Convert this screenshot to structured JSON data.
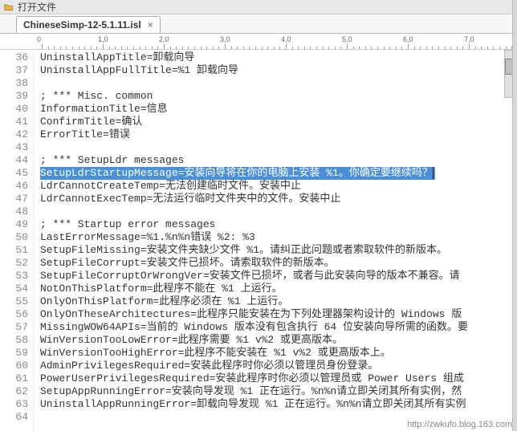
{
  "topbar": {
    "label": "打开文件"
  },
  "tab": {
    "filename": "ChineseSimp-12-5.1.11.isl",
    "close": "×"
  },
  "ruler": {
    "marks": [
      "0",
      "1,0",
      "2,0",
      "3,0",
      "4,0",
      "5,0",
      "6,0",
      "7,0"
    ]
  },
  "footer": {
    "url": "http://zwkufo.blog.163.com"
  },
  "lines": [
    {
      "n": 36,
      "t": "UninstallAppTitle=卸载向导"
    },
    {
      "n": 37,
      "t": "UninstallAppFullTitle=%1 卸载向导"
    },
    {
      "n": 38,
      "t": ""
    },
    {
      "n": 39,
      "t": "; *** Misc. common"
    },
    {
      "n": 40,
      "t": "InformationTitle=信息"
    },
    {
      "n": 41,
      "t": "ConfirmTitle=确认"
    },
    {
      "n": 42,
      "t": "ErrorTitle=错误"
    },
    {
      "n": 43,
      "t": ""
    },
    {
      "n": 44,
      "t": "; *** SetupLdr messages"
    },
    {
      "n": 45,
      "t": "SetupLdrStartupMessage=安装向导将在你的电脑上安装 %1。你确定要继续吗？",
      "hl": true
    },
    {
      "n": 46,
      "t": "LdrCannotCreateTemp=无法创建临时文件。安装中止"
    },
    {
      "n": 47,
      "t": "LdrCannotExecTemp=无法运行临时文件夹中的文件。安装中止"
    },
    {
      "n": 48,
      "t": ""
    },
    {
      "n": 49,
      "t": "; *** Startup error messages"
    },
    {
      "n": 50,
      "t": "LastErrorMessage=%1.%n%n错误 %2: %3"
    },
    {
      "n": 51,
      "t": "SetupFileMissing=安装文件夹缺少文件 %1。请纠正此问题或者索取软件的新版本。"
    },
    {
      "n": 52,
      "t": "SetupFileCorrupt=安装文件已损坏。请索取软件的新版本。"
    },
    {
      "n": 53,
      "t": "SetupFileCorruptOrWrongVer=安装文件已损坏，或者与此安装向导的版本不兼容。请"
    },
    {
      "n": 54,
      "t": "NotOnThisPlatform=此程序不能在 %1 上运行。"
    },
    {
      "n": 55,
      "t": "OnlyOnThisPlatform=此程序必须在 %1 上运行。"
    },
    {
      "n": 56,
      "t": "OnlyOnTheseArchitectures=此程序只能安装在为下列处理器架构设计的 Windows 版"
    },
    {
      "n": 57,
      "t": "MissingWOW64APIs=当前的 Windows 版本没有包含执行 64 位安装向导所需的函数。要"
    },
    {
      "n": 58,
      "t": "WinVersionTooLowError=此程序需要 %1 v%2 或更高版本。"
    },
    {
      "n": 59,
      "t": "WinVersionTooHighError=此程序不能安装在 %1 v%2 或更高版本上。"
    },
    {
      "n": 60,
      "t": "AdminPrivilegesRequired=安装此程序时你必须以管理员身份登录。"
    },
    {
      "n": 61,
      "t": "PowerUserPrivilegesRequired=安装此程序时你必须以管理员或 Power Users 组成"
    },
    {
      "n": 62,
      "t": "SetupAppRunningError=安装向导发现 %1 正在运行。%n%n请立即关闭其所有实例，然"
    },
    {
      "n": 63,
      "t": "UninstallAppRunningError=卸载向导发现 %1 正在运行。%n%n请立即关闭其所有实例"
    },
    {
      "n": 64,
      "t": ""
    }
  ]
}
